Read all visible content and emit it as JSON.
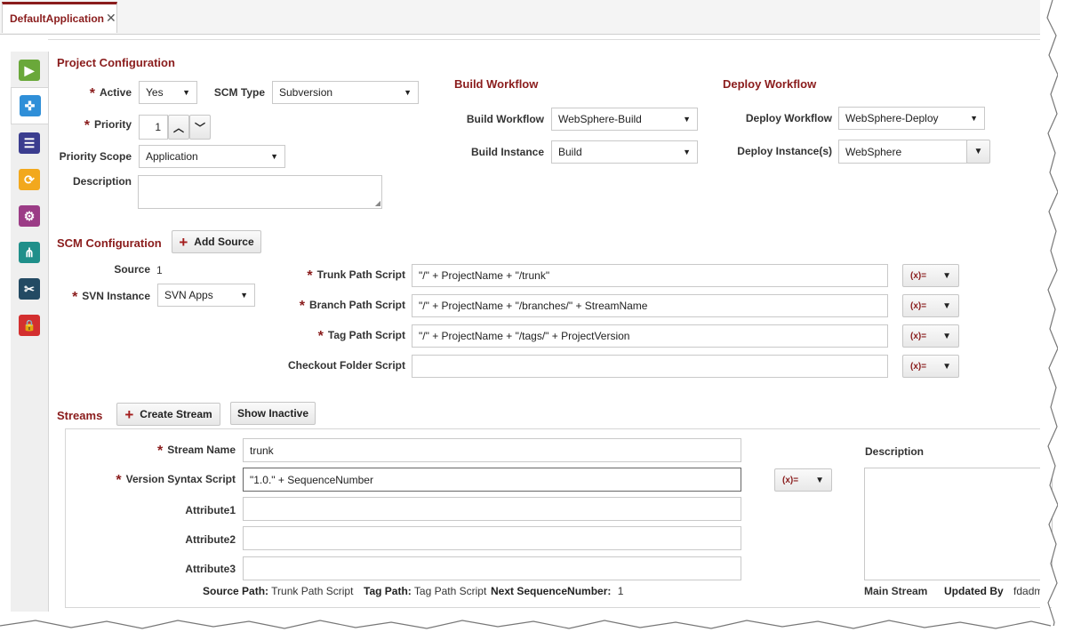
{
  "tab": {
    "title": "DefaultApplication",
    "close_glyph": "✕"
  },
  "sidebar": {
    "items": [
      {
        "icon": "play-icon",
        "color": "#6aa83a",
        "glyph": "▶"
      },
      {
        "icon": "network-icon",
        "color": "#2f8fd8",
        "glyph": "✜"
      },
      {
        "icon": "list-icon",
        "color": "#3b3d8f",
        "glyph": "☰"
      },
      {
        "icon": "refresh-icon",
        "color": "#f2a81d",
        "glyph": "⟳"
      },
      {
        "icon": "clipboard-gear-icon",
        "color": "#9b3c86",
        "glyph": "⚙"
      },
      {
        "icon": "share-icon",
        "color": "#1f8f8a",
        "glyph": "⋔"
      },
      {
        "icon": "tools-icon",
        "color": "#234a63",
        "glyph": "✂"
      },
      {
        "icon": "lock-icon",
        "color": "#d32f2f",
        "glyph": "🔒"
      }
    ]
  },
  "project": {
    "title": "Project Configuration",
    "active_label": "Active",
    "active_value": "Yes",
    "scm_type_label": "SCM Type",
    "scm_type_value": "Subversion",
    "priority_label": "Priority",
    "priority_value": "1",
    "priority_scope_label": "Priority Scope",
    "priority_scope_value": "Application",
    "description_label": "Description"
  },
  "build": {
    "title": "Build Workflow",
    "workflow_label": "Build Workflow",
    "workflow_value": "WebSphere-Build",
    "instance_label": "Build Instance",
    "instance_value": "Build"
  },
  "deploy": {
    "title": "Deploy Workflow",
    "workflow_label": "Deploy Workflow",
    "workflow_value": "WebSphere-Deploy",
    "instances_label": "Deploy Instance(s)",
    "instances_value": "WebSphere"
  },
  "scm": {
    "title": "SCM Configuration",
    "add_source_label": "Add Source",
    "source_label": "Source",
    "source_value": "1",
    "svn_instance_label": "SVN Instance",
    "svn_instance_value": "SVN Apps",
    "trunk_label": "Trunk Path Script",
    "trunk_value": "\"/\" + ProjectName + \"/trunk\"",
    "branch_label": "Branch Path Script",
    "branch_value": "\"/\" + ProjectName + \"/branches/\" + StreamName",
    "tag_label": "Tag Path Script",
    "tag_value": "\"/\" + ProjectName + \"/tags/\" + ProjectVersion",
    "checkout_label": "Checkout Folder Script",
    "checkout_value": "",
    "fx_label": "(x)="
  },
  "streams": {
    "title": "Streams",
    "create_label": "Create Stream",
    "show_inactive_label": "Show Inactive",
    "name_label": "Stream Name",
    "name_value": "trunk",
    "version_label": "Version Syntax Script",
    "version_value": "\"1.0.\" + SequenceNumber",
    "attr1_label": "Attribute1",
    "attr2_label": "Attribute2",
    "attr3_label": "Attribute3",
    "description_label": "Description",
    "source_path_label": "Source Path:",
    "source_path_value": "Trunk Path Script",
    "tag_path_label": "Tag Path:",
    "tag_path_value": "Tag Path Script",
    "next_seq_label": "Next SequenceNumber:",
    "next_seq_value": "1",
    "main_stream_label": "Main Stream",
    "updated_by_label": "Updated By",
    "updated_by_value": "fdadmin"
  }
}
